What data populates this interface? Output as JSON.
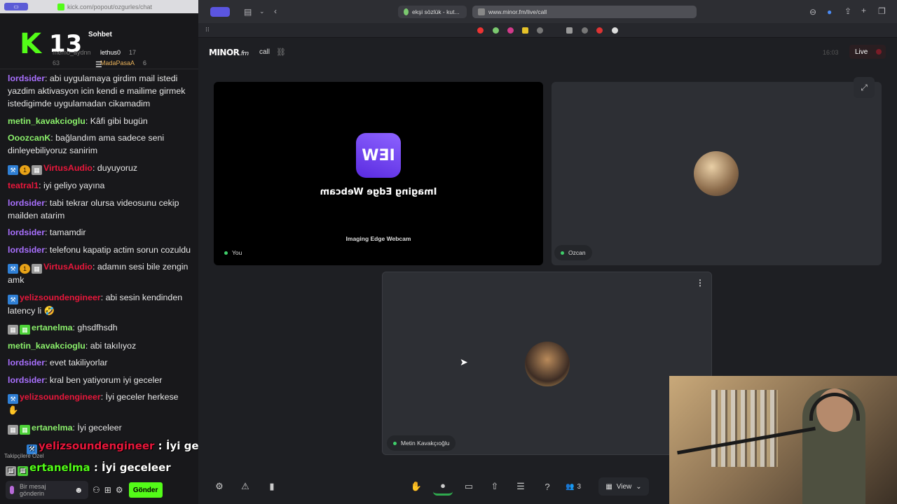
{
  "chat_window": {
    "url": "kick.com/popout/ozgurles/chat",
    "title": "Sohbet",
    "logo_letter": "K",
    "viewer_count": "13",
    "top_users": [
      {
        "name": "memo_aydnn",
        "count": "63",
        "side": "left"
      },
      {
        "name": "lethus0",
        "count": "17",
        "side": "right"
      },
      {
        "name": "MadaPasaA",
        "count": "6",
        "side": "right"
      }
    ],
    "messages": [
      {
        "user": "lordsider",
        "color": "#a970ff",
        "badges": [],
        "text": ": abi uygulamaya girdim mail istedi yazdim aktivasyon icin kendi e mailime girmek istedigimde uygulamadan cikamadim"
      },
      {
        "user": "metin_kavakcioglu",
        "color": "#8bf06b",
        "badges": [],
        "text": ": Kâfi gibi bugün"
      },
      {
        "user": "OoozcanK",
        "color": "#8bf06b",
        "badges": [],
        "text": ": bağlandım ama sadece seni dinleyebiliyoruz sanirim"
      },
      {
        "user": "VirtusAudio",
        "color": "#e8173b",
        "badges": [
          "blue",
          "gold",
          "grey"
        ],
        "text": ": duyuyoruz"
      },
      {
        "user": "teatral1",
        "color": "#e8173b",
        "badges": [],
        "text": ": iyi geliyo yayına"
      },
      {
        "user": "lordsider",
        "color": "#a970ff",
        "badges": [],
        "text": ": tabi tekrar olursa videosunu cekip mailden atarim"
      },
      {
        "user": "lordsider",
        "color": "#a970ff",
        "badges": [],
        "text": ": tamamdir"
      },
      {
        "user": "lordsider",
        "color": "#a970ff",
        "badges": [],
        "text": ": telefonu kapatip actim sorun cozuldu"
      },
      {
        "user": "VirtusAudio",
        "color": "#e8173b",
        "badges": [
          "blue",
          "gold",
          "grey"
        ],
        "text": ": adamın sesi bile zengin amk"
      },
      {
        "user": "yelizsoundengineer",
        "color": "#e8173b",
        "badges": [
          "blue"
        ],
        "text": ": abi sesin kendinden latency li 🤣"
      },
      {
        "user": "ertanelma",
        "color": "#8bf06b",
        "badges": [
          "grey",
          "green"
        ],
        "text": ": ghsdfhsdh"
      },
      {
        "user": "metin_kavakcioglu",
        "color": "#8bf06b",
        "badges": [],
        "text": ": abi takılıyoz"
      },
      {
        "user": "lordsider",
        "color": "#a970ff",
        "badges": [],
        "text": ": evet takiliyorlar"
      },
      {
        "user": "lordsider",
        "color": "#a970ff",
        "badges": [],
        "text": ": kral ben yatiyorum iyi geceler"
      },
      {
        "user": "yelizsoundengineer",
        "color": "#e8173b",
        "badges": [
          "blue"
        ],
        "text": ": İyi geceler herkese ✋"
      },
      {
        "user": "ertanelma",
        "color": "#8bf06b",
        "badges": [
          "grey",
          "green"
        ],
        "text": ": İyi geceleer"
      }
    ],
    "overlay_messages": [
      {
        "user": "yelizsoundengineer",
        "text": " : İyi geceler herkese ✋"
      },
      {
        "user": "ertanelma",
        "text": " : İyi geceleer"
      }
    ],
    "followers_label": "Takipçilere Özel",
    "input_placeholder": "Bir mesaj gönderin",
    "send_label": "Gönder"
  },
  "browser": {
    "tabs": [
      {
        "title": "ekşi sözlük - kut..."
      },
      {
        "title": "www.minor.fm/live/call"
      }
    ]
  },
  "app": {
    "brand": "MINOR",
    "brand_suffix": ".fm",
    "room": "call",
    "clock": "16:03",
    "live_label": "Live",
    "tiles": {
      "you": {
        "logo_text": "IEW",
        "camera_name": "Imaging Edge Webcam",
        "caption": "Imaging Edge Webcam",
        "label": "You"
      },
      "ozcan": {
        "label": "Ozcan"
      },
      "metin": {
        "label": "Metin Kavakçıoğlu"
      }
    },
    "participant_count": "3",
    "view_label": "View"
  }
}
